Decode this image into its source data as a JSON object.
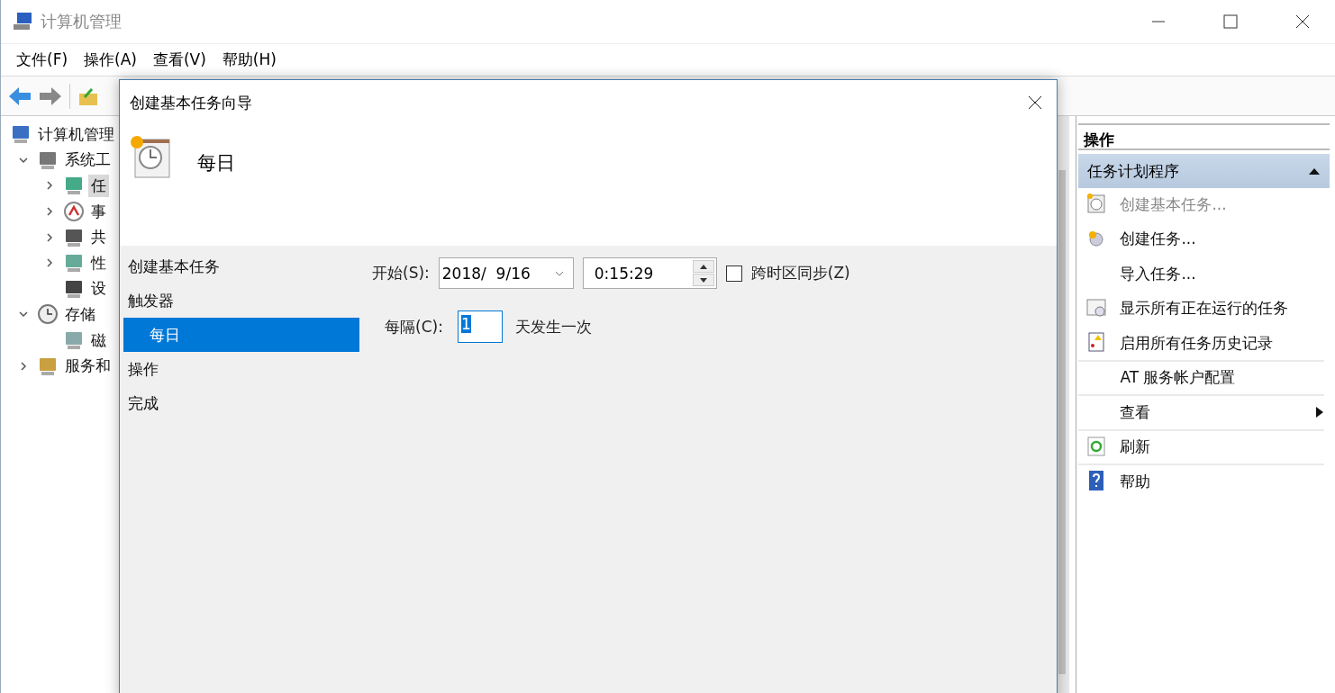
{
  "window": {
    "title": "计算机管理"
  },
  "menu": [
    "文件(F)",
    "操作(A)",
    "查看(V)",
    "帮助(H)"
  ],
  "tree": [
    {
      "label": "计算机管理",
      "selected": false,
      "children": [
        {
          "label": "系统工",
          "selected": false,
          "expanded": true,
          "children": [
            {
              "label": "任",
              "selected": true,
              "expanded": false
            },
            {
              "label": "事",
              "selected": false,
              "expanded": false
            },
            {
              "label": "共",
              "selected": false,
              "expanded": false
            },
            {
              "label": "性",
              "selected": false,
              "expanded": false
            },
            {
              "label": "设",
              "selected": false
            }
          ]
        },
        {
          "label": "存储",
          "selected": false,
          "expanded": true,
          "children": [
            {
              "label": "磁",
              "selected": false
            }
          ]
        },
        {
          "label": "服务和",
          "selected": false,
          "expanded": false
        }
      ]
    }
  ],
  "actions": {
    "title": "操作",
    "section": {
      "label": "任务计划程序",
      "expanded": true
    },
    "items": [
      {
        "label": "创建基本任务...",
        "kind": "command",
        "disabled": true,
        "divider_after": false
      },
      {
        "label": "创建任务...",
        "kind": "command",
        "disabled": false,
        "divider_after": false
      },
      {
        "label": "导入任务...",
        "kind": "command",
        "disabled": false,
        "divider_after": false
      },
      {
        "label": "显示所有正在运行的任务",
        "kind": "command",
        "disabled": false,
        "divider_after": false
      },
      {
        "label": "启用所有任务历史记录",
        "kind": "command",
        "disabled": false,
        "divider_after": true
      },
      {
        "label": "AT 服务帐户配置",
        "kind": "command",
        "disabled": false,
        "divider_after": true
      },
      {
        "label": "查看",
        "kind": "submenu",
        "disabled": false,
        "divider_after": true
      },
      {
        "label": "刷新",
        "kind": "command",
        "disabled": false,
        "divider_after": true
      },
      {
        "label": "帮助",
        "kind": "command",
        "disabled": false,
        "divider_after": false
      }
    ]
  },
  "dialog": {
    "title": "创建基本任务向导",
    "heading": "每日",
    "steps": [
      {
        "label": "创建基本任务",
        "selected": false
      },
      {
        "label": "触发器",
        "selected": false,
        "children": [
          {
            "label": "每日",
            "selected": true
          }
        ]
      },
      {
        "label": "操作",
        "selected": false
      },
      {
        "label": "完成",
        "selected": false
      }
    ],
    "start": {
      "label": "开始(S):",
      "date": "2018/  9/16",
      "time": "0:15:29"
    },
    "sync_timezones": {
      "label": "跨时区同步(Z)",
      "checked": false
    },
    "recur": {
      "label": "每隔(C):",
      "value": "1",
      "suffix": "天发生一次"
    }
  }
}
